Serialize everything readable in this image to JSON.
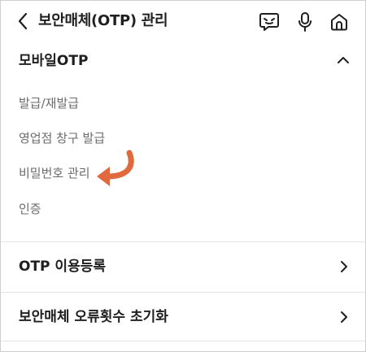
{
  "header": {
    "title": "보안매체(OTP) 관리",
    "back_icon": "back-arrow-icon",
    "icons": [
      "chatbot-icon",
      "microphone-icon",
      "home-icon"
    ]
  },
  "section": {
    "title": "모바일OTP",
    "expanded": true,
    "items": [
      {
        "label": "발급/재발급"
      },
      {
        "label": "영업점 창구 발급"
      },
      {
        "label": "비밀번호 관리",
        "highlighted": true
      },
      {
        "label": "인증"
      }
    ]
  },
  "rows": [
    {
      "label": "OTP 이용등록"
    },
    {
      "label": "보안매체 오류횟수 초기화"
    }
  ],
  "colors": {
    "text_primary": "#1f1f1f",
    "text_secondary": "#6b6b6b",
    "divider": "#e4e4e4",
    "pointer_arrow": "#e06a3d"
  }
}
